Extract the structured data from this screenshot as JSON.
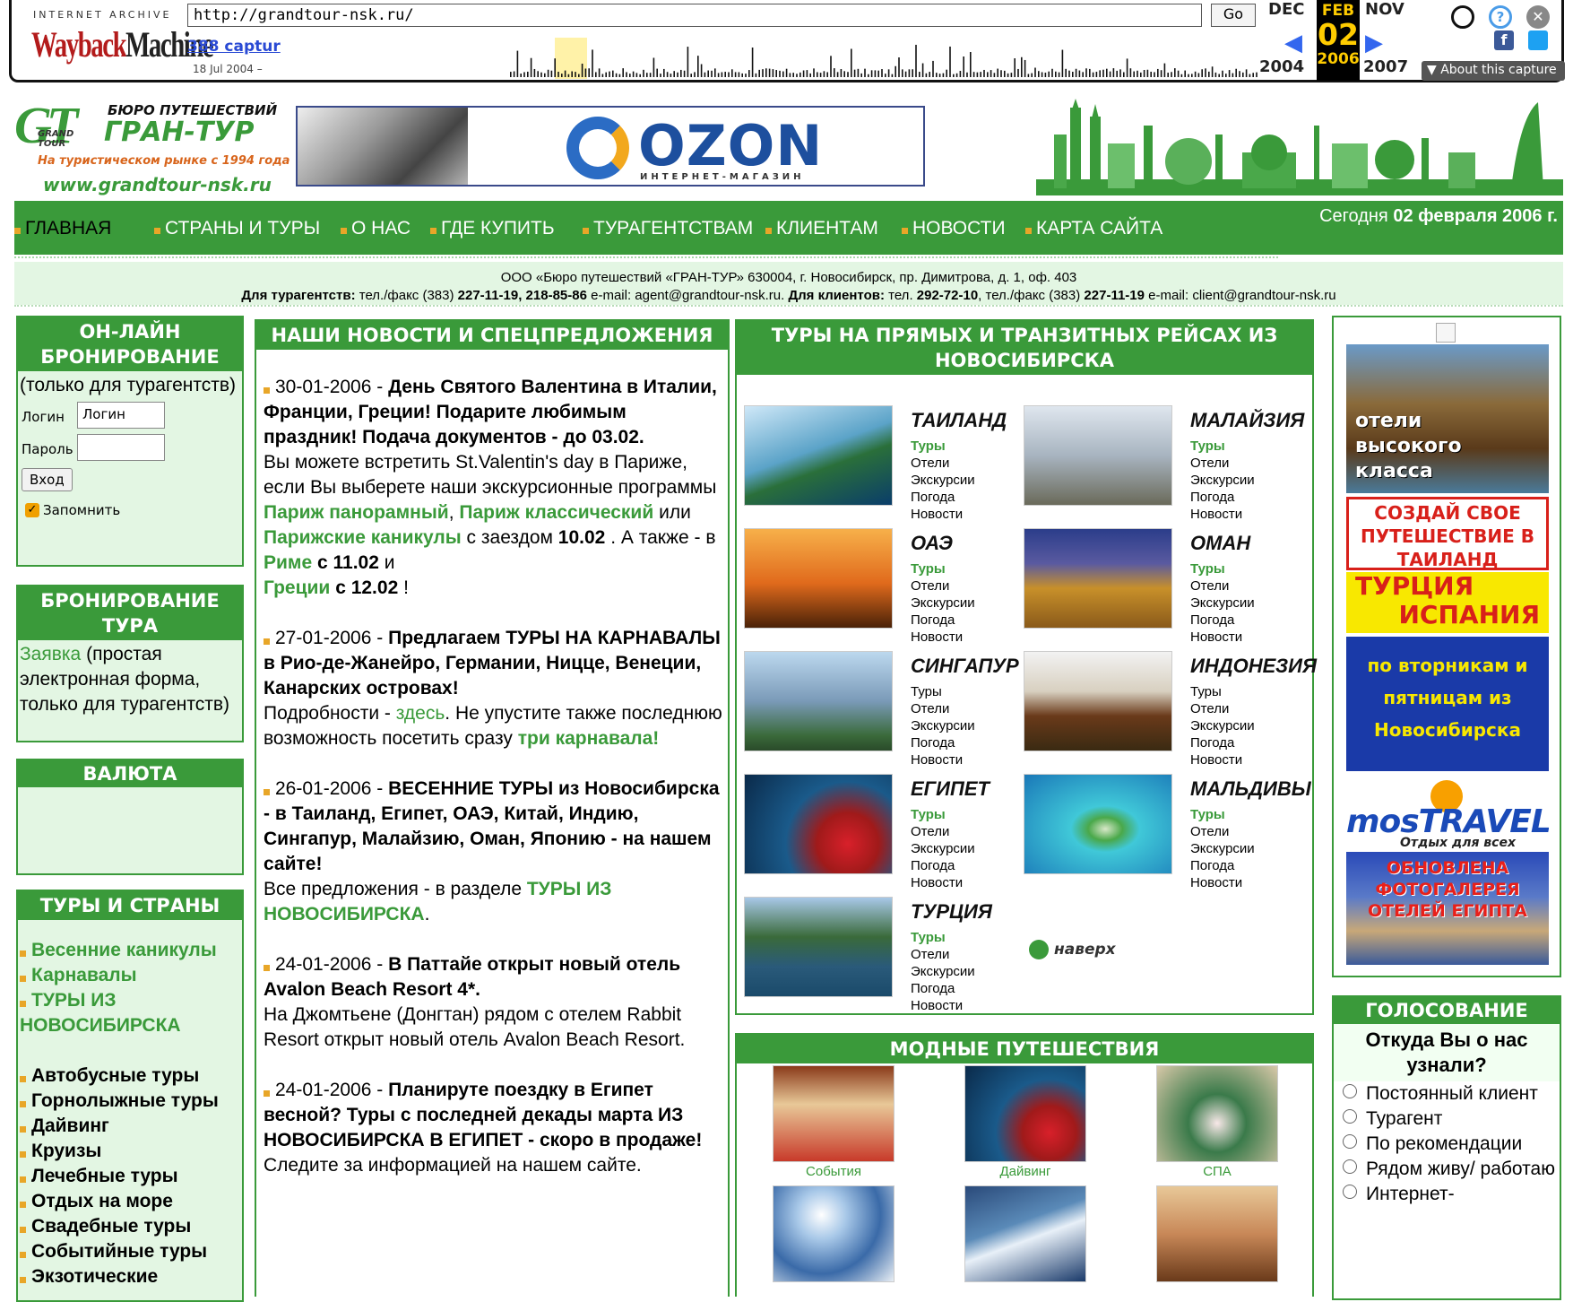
{
  "wayback": {
    "logo_top": "INTERNET ARCHIVE",
    "logo_main": "Wayback",
    "logo_main2": "Machine",
    "url": "http://grandtour-nsk.ru/",
    "go_label": "Go",
    "captures": "388 captur",
    "date_range": "18 Jul 2004 –",
    "prev_month": "DEC",
    "cur_month": "FEB",
    "next_month": "NOV",
    "prev_year": "2004",
    "cur_day": "02",
    "cur_year": "2006",
    "next_year": "2007",
    "about": "About this capture"
  },
  "logo": {
    "gt": "GT",
    "small": "GRAND TOUR",
    "bureau": "БЮРО ПУТЕШЕСТВИЙ",
    "name": "ГРАН-ТУР",
    "tagline": "На туристическом рынке с 1994 года",
    "url": "www.grandtour-nsk.ru"
  },
  "ozon": {
    "name": "OZON",
    "sub": "ИНТЕРНЕТ-МАГАЗИН"
  },
  "nav": {
    "items": [
      "ГЛАВНАЯ",
      "СТРАНЫ И ТУРЫ",
      "О НАС",
      "ГДЕ КУПИТЬ",
      "ТУРАГЕНТСТВАМ",
      "КЛИЕНТАМ",
      "НОВОСТИ",
      "КАРТА САЙТА"
    ],
    "date_prefix": "Сегодня",
    "date_value": "02 февраля 2006 г."
  },
  "infobar": {
    "line1": "ООО «Бюро путешествий «ГРАН-ТУР» 630004, г. Новосибирск, пр. Димитрова, д. 1, оф. 403",
    "agents_label": "Для турагентств:",
    "agents_tel_label": "тел./факс (383)",
    "agents_tel": "227-11-19, 218-85-86",
    "agents_email": "e-mail: agent@grandtour-nsk.ru.",
    "clients_label": "Для клиентов:",
    "clients_tel_label": "тел.",
    "clients_tel": "292-72-10",
    "clients_fax_label": ", тел./факс (383)",
    "clients_fax": "227-11-19",
    "clients_email": "e-mail: client@grandtour-nsk.ru"
  },
  "online_booking": {
    "title": "ОН-ЛАЙН БРОНИРОВАНИЕ",
    "note": "(только для турагентств)",
    "login_label": "Логин",
    "login_value": "Логин",
    "password_label": "Пароль",
    "submit": "Вход",
    "remember": "Запомнить"
  },
  "tour_booking": {
    "title": "БРОНИРОВАНИЕ ТУРА",
    "link": "Заявка",
    "text": "(простая электронная форма, только для турагентств)"
  },
  "currency": {
    "title": "ВАЛЮТА"
  },
  "tours_countries": {
    "title": "ТУРЫ И СТРАНЫ",
    "green": [
      "Весенние каникулы",
      "Карнавалы",
      "ТУРЫ ИЗ НОВОСИБИРСКА"
    ],
    "black": [
      "Автобусные туры",
      "Горнолыжные туры",
      "Дайвинг",
      "Круизы",
      "Лечебные туры",
      "Отдых на море",
      "Свадебные туры",
      "Событийные туры",
      "Экзотические"
    ]
  },
  "news": {
    "title": "НАШИ НОВОСТИ И СПЕЦПРЕДЛОЖЕНИЯ",
    "items": [
      {
        "date": "30-01-2006",
        "headline": "День Святого Валентина в Италии, Франции, Греции! Подарите любимым праздник! Подача документов - до 03.02.",
        "t1": "Вы можете встретить St.Valentin's day в Париже, если Вы выберете наши экскурсионные программы ",
        "l1": "Париж панорамный",
        "t2": ", ",
        "l2": "Париж классический",
        "t3": " или ",
        "l3": "Парижские каникулы",
        "t4": " с заездом ",
        "b1": "10.02",
        "t5": " . А также - в ",
        "l4": "Риме",
        "b2": "с 11.02",
        "t6": " и ",
        "l5": "Греции",
        "b3": "с 12.02",
        "t7": " !"
      },
      {
        "date": "27-01-2006",
        "headline": "Предлагаем ТУРЫ НА КАРНАВАЛЫ в Рио-де-Жанейро, Германии, Ницце, Венеции, Канарских островах!",
        "t1": "Подробности - ",
        "l1": "здесь",
        "t2": ". Не упустите также последнюю возможность посетить сразу ",
        "l2": "три карнавала!"
      },
      {
        "date": "26-01-2006",
        "headline": "ВЕСЕННИЕ ТУРЫ из Новосибирска - в Таиланд, Египет, ОАЭ, Китай, Индию, Сингапур, Малайзию, Оман, Японию - на нашем сайте!",
        "t1": "Все предложения - в разделе ",
        "l1": "ТУРЫ ИЗ НОВОСИБИРСКА",
        "t2": "."
      },
      {
        "date": "24-01-2006",
        "headline": "В Паттайе открыт новый отель Avalon Beach Resort 4*.",
        "t1": "На Джомтьене (Донгтан) рядом с отелем Rabbit Resort открыт новый отель Avalon Beach Resort."
      },
      {
        "date": "24-01-2006",
        "headline": "Планируте поездку в Египет весной? Туры с последней декады марта ИЗ НОВОСИБИРСКА В ЕГИПЕТ - скоро в продаже!",
        "t1": "Следите за информацией на нашем сайте."
      }
    ]
  },
  "tours": {
    "title": "ТУРЫ НА ПРЯМЫХ И ТРАНЗИТНЫХ РЕЙСАХ ИЗ НОВОСИБИРСКА",
    "sub_items": [
      "Туры",
      "Отели",
      "Экскурсии",
      "Погода",
      "Новости"
    ],
    "countries": [
      "ТАИЛАНД",
      "МАЛАЙЗИЯ",
      "ОАЭ",
      "ОМАН",
      "СИНГАПУР",
      "ИНДОНЕЗИЯ",
      "ЕГИПЕТ",
      "МАЛЬДИВЫ",
      "ТУРЦИЯ"
    ],
    "up": "наверх"
  },
  "fashion": {
    "title": "МОДНЫЕ ПУТЕШЕСТВИЯ",
    "captions": [
      "События",
      "Дайвинг",
      "СПА"
    ]
  },
  "ads": {
    "hotels": "отели высокого класса",
    "create": "СОЗДАЙ СВОЕ ПУТЕШЕСТВИЕ В ТАИЛАНД",
    "turkey": "ТУРЦИЯ",
    "spain": "ИСПАНИЯ",
    "days": "по вторникам и пятницам из Новосибирска",
    "mostravel": "mosTRAVEL",
    "mostravel_sub": "Отдых для всех",
    "gallery": "ОБНОВЛЕНА ФОТОГАЛЕРЕЯ ОТЕЛЕЙ ЕГИПТА"
  },
  "poll": {
    "title": "ГОЛОСОВАНИЕ",
    "question": "Откуда Вы о нас узнали?",
    "options": [
      "Постоянный клиент",
      "Турагент",
      "По рекомендации",
      "Рядом живу/ работаю",
      "Интернет-"
    ]
  }
}
